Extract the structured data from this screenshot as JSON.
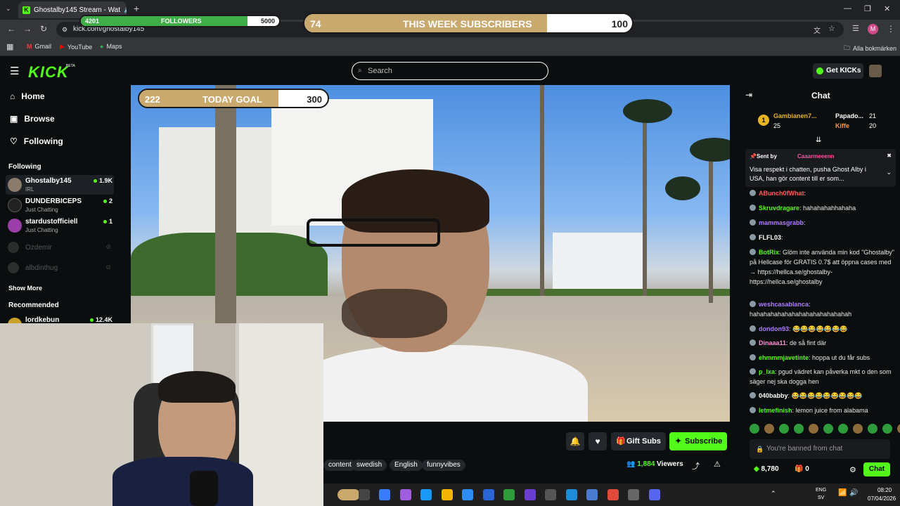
{
  "browser": {
    "tab_title": "Ghostalby145 Stream - Wat",
    "url": "kick.com/ghostalby145",
    "bookmarks": [
      "Gmail",
      "YouTube",
      "Maps"
    ],
    "all_bookmarks": "Alla bokmärken",
    "profile_initial": "M"
  },
  "overlays": {
    "followers": {
      "label": "FOLLOWERS",
      "current": "4201",
      "goal": "5000",
      "fraction": 0.84
    },
    "week": {
      "label": "THIS WEEK SUBSCRIBERS",
      "current": "74",
      "goal": "100",
      "fraction": 0.74
    },
    "today": {
      "label": "TODAY GOAL",
      "current": "222",
      "goal": "300",
      "fraction": 0.74
    }
  },
  "header": {
    "logo": "KICK",
    "logo_badge": "BETA",
    "search_placeholder": "Search",
    "get_kicks": "Get KICKs"
  },
  "sidebar": {
    "nav": [
      {
        "label": "Home",
        "icon": "home-icon"
      },
      {
        "label": "Browse",
        "icon": "browse-icon"
      },
      {
        "label": "Following",
        "icon": "heart-icon"
      }
    ],
    "following_title": "Following",
    "following": [
      {
        "name": "Ghostalby145",
        "category": "IRL",
        "viewers": "1.9K",
        "live": true
      },
      {
        "name": "DUNDERBICEPS",
        "category": "Just Chatting",
        "viewers": "2",
        "live": true
      },
      {
        "name": "stardustofficiell",
        "category": "Just Chatting",
        "viewers": "1",
        "live": true
      },
      {
        "name": "Ozdemir",
        "category": "",
        "viewers": "",
        "live": false
      },
      {
        "name": "albdinthug",
        "category": "",
        "viewers": "",
        "live": false
      }
    ],
    "show_more": "Show More",
    "recommended_title": "Recommended",
    "recommended": [
      {
        "name": "lordkebun",
        "viewers": "12.4K"
      }
    ]
  },
  "player": {
    "gift_subs": "Gift Subs",
    "subscribe": "Subscribe",
    "tags": [
      "content",
      "swedish",
      "English",
      "funnyvibes"
    ],
    "viewers": "1,884",
    "viewers_label": "Viewers"
  },
  "chat": {
    "title": "Chat",
    "leaderboard": [
      {
        "rank": "1",
        "name": "Gambianen7...",
        "count": "25"
      },
      {
        "name": "Papado...",
        "count": "21"
      },
      {
        "name": "Kiffe",
        "count": "20"
      }
    ],
    "pinned": {
      "sent_by": "Sent by",
      "user": "Caaarmeeenn",
      "text": "Visa respekt i chatten, pusha Ghost Alby i USA, han gör content till er som..."
    },
    "messages": [
      {
        "user": "ABunch0fWhat",
        "color": "#ff5c5c",
        "text": ""
      },
      {
        "user": "Skruvdragare",
        "color": "#53fc18",
        "text": "hahahahahhahaha"
      },
      {
        "user": "mammasgrabb",
        "color": "#b07cff",
        "text": ""
      },
      {
        "user": "FLFL03",
        "color": "#ffffff",
        "text": ""
      },
      {
        "user": "BotRix",
        "color": "#53fc18",
        "text": "Glöm inte använda min kod \"Ghostalby\" på Hellcase för GRATIS 0.7$ att öppna cases med → https://hellca.se/ghostalby- https://hellca.se/ghostalby"
      },
      {
        "user": "weshcasablanca",
        "color": "#b07cff",
        "text": "hahahahahahahahahahahahahahah"
      },
      {
        "user": "dondon93",
        "color": "#b07cff",
        "text": "😂😂😂😂😂😂😂"
      },
      {
        "user": "Dinaaa11",
        "color": "#ff8fd6",
        "text": "de så fint där"
      },
      {
        "user": "ehmmmjavetinte",
        "color": "#53fc18",
        "text": "hoppa ut du får subs"
      },
      {
        "user": "p_lxa",
        "color": "#53fc18",
        "text": "pgud vädret kan påverka mkt o den som säger nej ska dogga hen"
      },
      {
        "user": "040babby",
        "color": "#ffffff",
        "text": "😂😂😂😂😂😂😂😂😂"
      },
      {
        "user": "letmefinish",
        "color": "#53fc18",
        "text": "lemon juice from alabama"
      }
    ],
    "banned": "You're banned from chat",
    "points": "8,780",
    "gifts": "0",
    "chat_button": "Chat"
  },
  "taskbar": {
    "lang": "ENG",
    "lang2": "SV",
    "time": "08:20",
    "date": "07/04/2026"
  },
  "colors": {
    "kick_green": "#53fc18",
    "bg": "#0b0e0f",
    "surface": "#24272c"
  }
}
